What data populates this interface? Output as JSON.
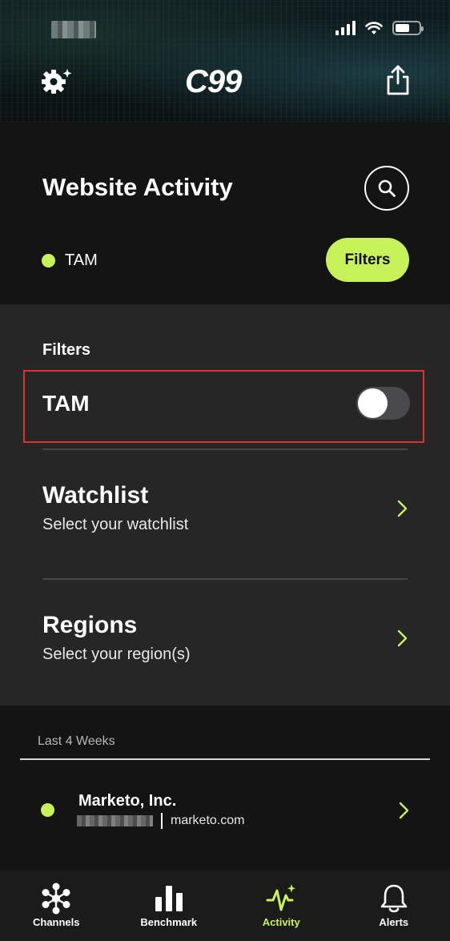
{
  "app": {
    "logo_text": "C99",
    "accent_color": "#c8f25a"
  },
  "header": {
    "title": "Website Activity",
    "active_filter_tag": "TAM",
    "filters_button_label": "Filters"
  },
  "filter_panel": {
    "heading": "Filters",
    "tam": {
      "label": "TAM",
      "enabled": false
    },
    "watchlist": {
      "title": "Watchlist",
      "subtitle": "Select your watchlist"
    },
    "regions": {
      "title": "Regions",
      "subtitle": "Select your region(s)"
    }
  },
  "activity": {
    "period_label": "Last 4 Weeks",
    "items": [
      {
        "name": "Marketo, Inc.",
        "domain": "marketo.com"
      }
    ]
  },
  "tabbar": {
    "tabs": [
      {
        "label": "Channels",
        "icon": "channels-icon"
      },
      {
        "label": "Benchmark",
        "icon": "bar-chart-icon"
      },
      {
        "label": "Activity",
        "icon": "activity-pulse-icon",
        "active": true
      },
      {
        "label": "Alerts",
        "icon": "bell-icon"
      }
    ]
  }
}
